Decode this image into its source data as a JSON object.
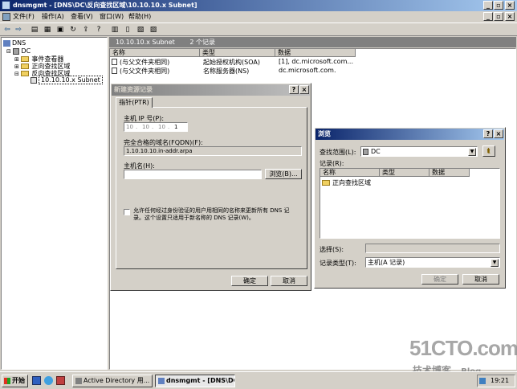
{
  "main_window": {
    "title": "dnsmgmt - [DNS\\DC\\反向查找区域\\10.10.10.x Subnet]",
    "menu": [
      "文件(F)",
      "操作(A)",
      "查看(V)",
      "窗口(W)",
      "帮助(H)"
    ]
  },
  "tree": {
    "root": "DNS",
    "server": "DC",
    "items": [
      "事件查看器",
      "正向查找区域",
      "反向查找区域"
    ],
    "selected": "10.10.10.x Subnet"
  },
  "zone_header": {
    "name": "10.10.10.x Subnet",
    "count": "2 个记录"
  },
  "records_table": {
    "columns": [
      "名称",
      "类型",
      "数据"
    ],
    "rows": [
      {
        "name": "(与父文件夹相同)",
        "type": "起始授权机构(SOA)",
        "data": "[1], dc.microsoft.com..."
      },
      {
        "name": "(与父文件夹相同)",
        "type": "名称服务器(NS)",
        "data": "dc.microsoft.com."
      }
    ]
  },
  "new_record_dialog": {
    "title": "新建资源记录",
    "tab": "指针(PTR)",
    "host_ip_label": "主机 IP 号(P):",
    "ip_octets": [
      "10",
      "10",
      "10",
      "1"
    ],
    "fqdn_label": "完全合格的域名(FQDN)(F):",
    "fqdn_value": "1.10.10.10.in-addr.arpa",
    "host_name_label": "主机名(H):",
    "browse_label": "浏览(B)...",
    "checkbox_text_1": "允许任何经过身份验证的用户用相同的名称来更新所有 DNS 记",
    "checkbox_text_2": "录。这个设置只适用于新名称的 DNS 记录(W)。",
    "ok_label": "确定",
    "cancel_label": "取消"
  },
  "browse_dialog": {
    "title": "浏览",
    "look_in_label": "查找范围(L):",
    "look_in_value": "DC",
    "records_label": "记录(R):",
    "columns": [
      "名称",
      "类型",
      "数据"
    ],
    "items": [
      {
        "name": "正向查找区域"
      }
    ],
    "selection_label": "选择(S):",
    "record_type_label": "记录类型(T):",
    "record_type_value": "主机(A 记录)",
    "ok_label": "确定",
    "cancel_label": "取消"
  },
  "taskbar": {
    "start_label": "开始",
    "tasks": [
      "Active Directory 用...",
      "dnsmgmt - [DNS\\DC\\..."
    ],
    "clock": "19:21"
  },
  "watermark": {
    "brand": "51CTO.com",
    "blog": "技术博客",
    "blog_suffix": "Blog"
  }
}
